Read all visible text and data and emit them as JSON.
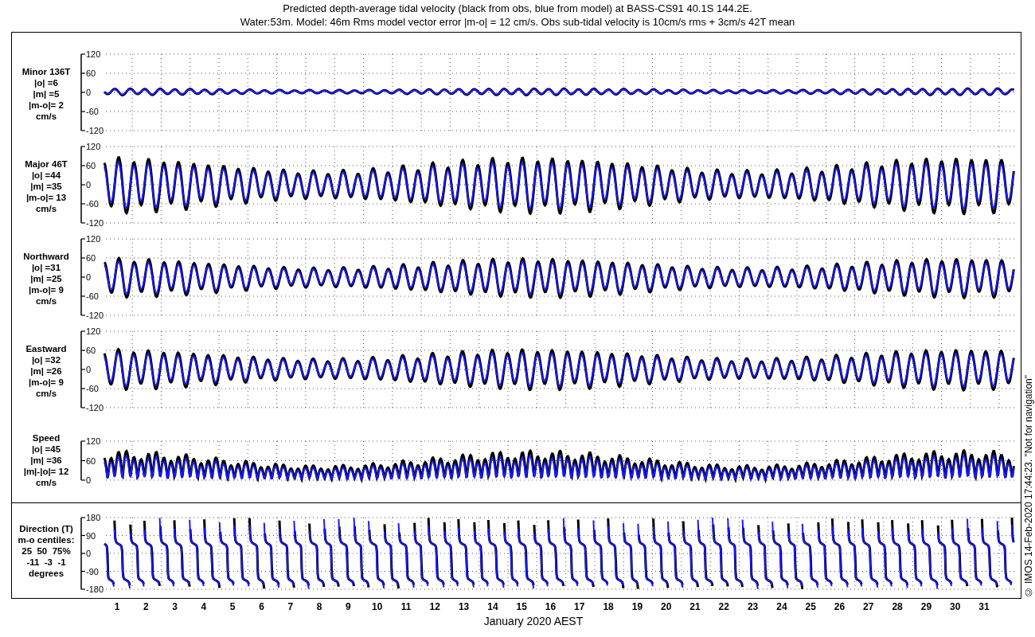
{
  "title": [
    "Predicted depth-average tidal velocity (black from obs, blue from model) at BASS-CS91 40.1S 144.2E.",
    "Water:53m. Model: 46m  Rms model vector error |m-o| = 12 cm/s. Obs sub-tidal velocity is 10cm/s rms + 3cm/s 42T mean"
  ],
  "panels": [
    {
      "kind": "minor",
      "label": [
        "Minor 136T",
        "|o| =6",
        "|m| =5",
        "|m-o|= 2",
        "cm/s"
      ],
      "yticks": [
        "120",
        "60",
        "0",
        "-60",
        "-120"
      ]
    },
    {
      "kind": "major",
      "label": [
        "Major 46T",
        "|o| =44",
        "|m| =35",
        "|m-o|= 13",
        "cm/s"
      ],
      "yticks": [
        "120",
        "60",
        "0",
        "-60",
        "-120"
      ]
    },
    {
      "kind": "northward",
      "label": [
        "Northward",
        "|o| =31",
        "|m| =25",
        "|m-o|= 9",
        "cm/s"
      ],
      "yticks": [
        "120",
        "60",
        "0",
        "-60",
        "-120"
      ]
    },
    {
      "kind": "eastward",
      "label": [
        "Eastward",
        "|o| =32",
        "|m| =26",
        "|m-o|= 9",
        "cm/s"
      ],
      "yticks": [
        "120",
        "60",
        "0",
        "-60",
        "-120"
      ]
    },
    {
      "kind": "speed",
      "label": [
        "Speed",
        "|o| =45",
        "|m| =36",
        "|m|-|o|= 12",
        "cm/s"
      ],
      "yticks": [
        "120",
        "60",
        "0"
      ]
    },
    {
      "kind": "direction",
      "label": [
        "Direction (T)",
        "m-o centiles:",
        "25  50  75%",
        "-11  -3  -1",
        "degrees"
      ],
      "yticks": [
        "180",
        "90",
        "0",
        "-90",
        "-180"
      ]
    }
  ],
  "x_tick_labels": [
    "1",
    "2",
    "3",
    "4",
    "5",
    "6",
    "7",
    "8",
    "9",
    "10",
    "11",
    "12",
    "13",
    "14",
    "15",
    "16",
    "17",
    "18",
    "19",
    "20",
    "21",
    "22",
    "23",
    "24",
    "25",
    "26",
    "27",
    "28",
    "29",
    "30",
    "31"
  ],
  "xlabel": "January 2020 AEST",
  "note": "© IMOS 14-Feb-2020 17:44:23. \"Not for navigation\""
}
